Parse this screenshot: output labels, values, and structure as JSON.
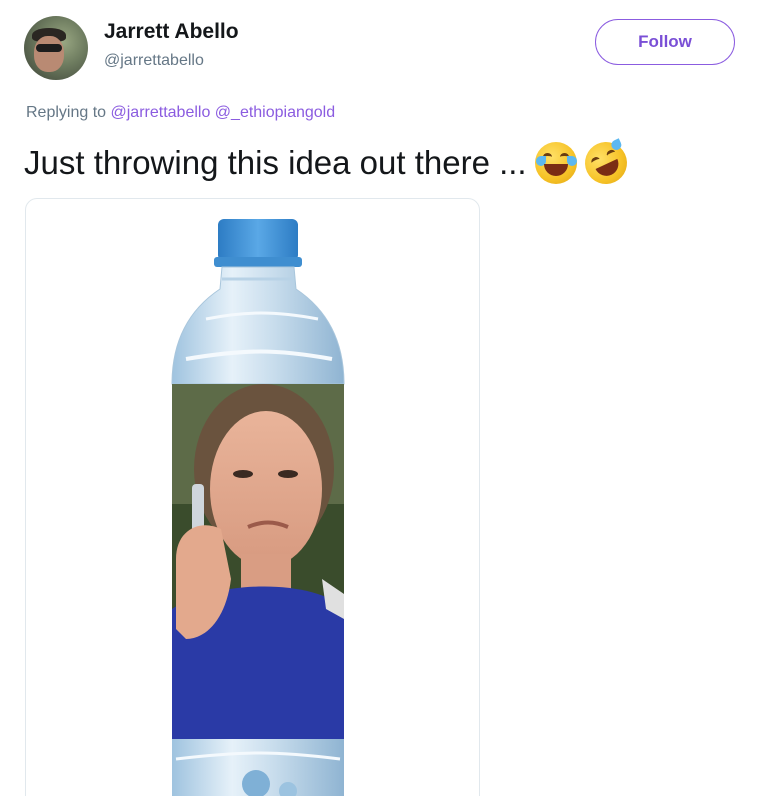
{
  "author": {
    "name": "Jarrett Abello",
    "handle": "@jarrettabello"
  },
  "follow_button": {
    "label": "Follow"
  },
  "reply": {
    "prefix": "Replying to",
    "mentions": [
      "@jarrettabello",
      "@_ethiopiangold"
    ]
  },
  "tweet": {
    "text": "Just throwing this idea out there ..."
  },
  "emoji": [
    "face-with-tears-of-joy-icon",
    "rolling-on-floor-laughing-icon"
  ],
  "colors": {
    "accent": "#8b5ce0",
    "text": "#14171a",
    "secondary_text": "#657786",
    "bottle_cap": "#3a8fd6"
  }
}
